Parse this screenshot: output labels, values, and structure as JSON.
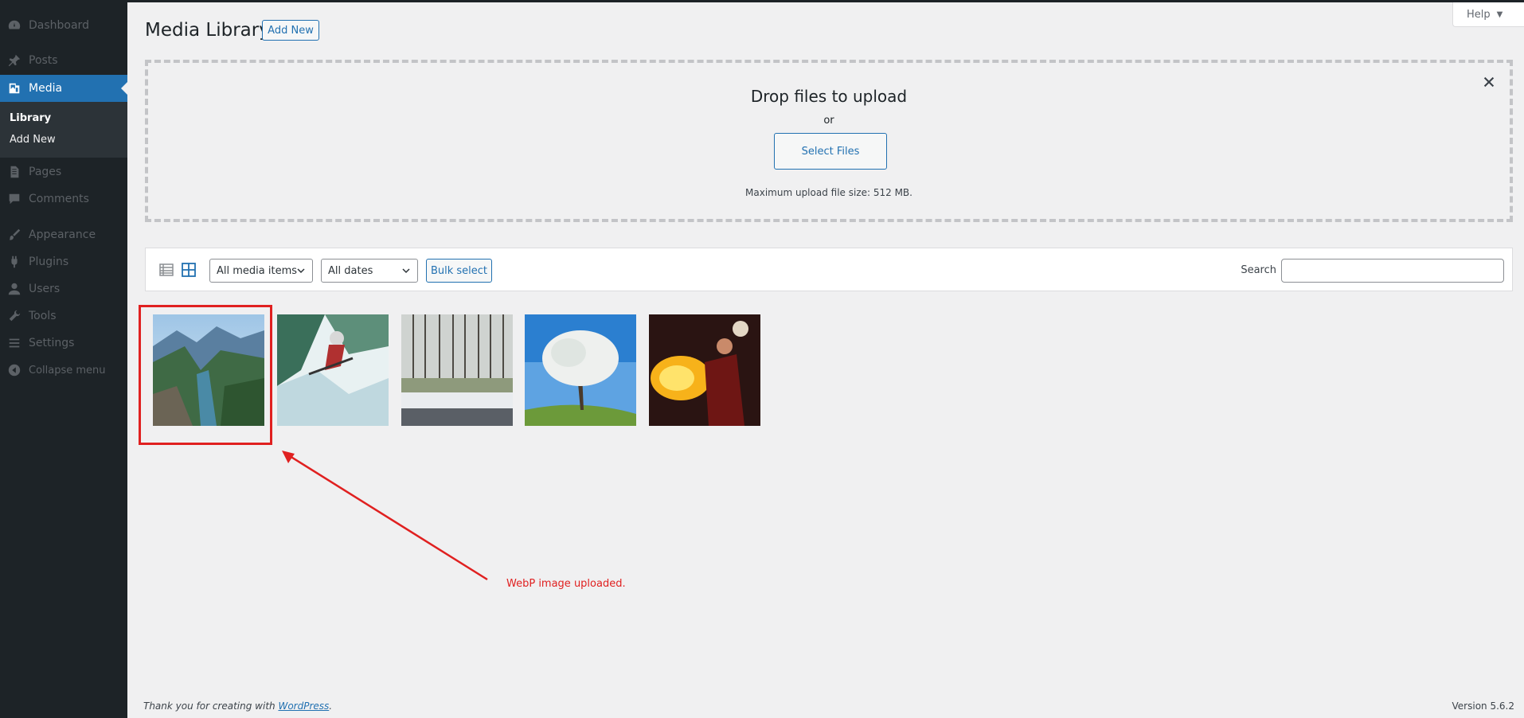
{
  "sidebar": {
    "items": [
      {
        "label": "Dashboard",
        "icon": "dashboard-icon"
      },
      {
        "label": "Posts",
        "icon": "pin-icon"
      },
      {
        "label": "Media",
        "icon": "media-icon",
        "active": true
      },
      {
        "label": "Pages",
        "icon": "pages-icon"
      },
      {
        "label": "Comments",
        "icon": "comments-icon"
      },
      {
        "label": "Appearance",
        "icon": "brush-icon"
      },
      {
        "label": "Plugins",
        "icon": "plug-icon"
      },
      {
        "label": "Users",
        "icon": "users-icon"
      },
      {
        "label": "Tools",
        "icon": "wrench-icon"
      },
      {
        "label": "Settings",
        "icon": "settings-icon"
      },
      {
        "label": "Collapse menu",
        "icon": "collapse-icon"
      }
    ],
    "submenu": [
      "Library",
      "Add New"
    ]
  },
  "header": {
    "title": "Media Library",
    "add_new": "Add New",
    "help": "Help"
  },
  "uploader": {
    "title": "Drop files to upload",
    "or": "or",
    "select_files": "Select Files",
    "max_size": "Maximum upload file size: 512 MB."
  },
  "toolbar": {
    "media_filter": "All media items",
    "date_filter": "All dates",
    "bulk_select": "Bulk select",
    "search_label": "Search",
    "search_value": ""
  },
  "annotation": "WebP image uploaded.",
  "footer": {
    "thank_you": "Thank you for creating with ",
    "wordpress": "WordPress",
    "period": ".",
    "version": "Version 5.6.2"
  },
  "colors": {
    "sidebar_bg": "#1d2327",
    "accent": "#2271b1",
    "annotation_red": "#e02020"
  }
}
